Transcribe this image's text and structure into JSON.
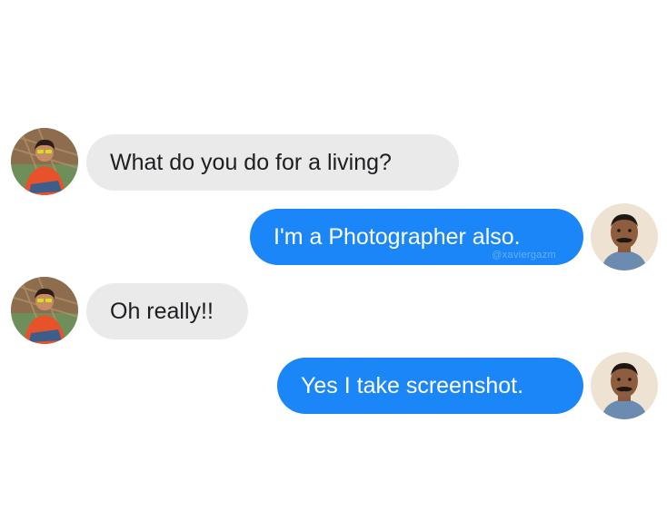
{
  "messages": [
    {
      "direction": "incoming",
      "text": "What do you do for a living?",
      "avatar": "young-man-avatar"
    },
    {
      "direction": "outgoing",
      "text": "I'm a Photographer also.",
      "watermark": "@xaviergazm",
      "avatar": "middle-aged-man-avatar"
    },
    {
      "direction": "incoming",
      "text": "Oh really!!",
      "avatar": "young-man-avatar"
    },
    {
      "direction": "outgoing",
      "text": "Yes I take screenshot.",
      "avatar": "middle-aged-man-avatar"
    }
  ],
  "colors": {
    "incoming_bubble": "#eaeaea",
    "incoming_text": "#1c1e21",
    "outgoing_bubble": "#1a86f7",
    "outgoing_text": "#ffffff",
    "background": "#ffffff"
  }
}
